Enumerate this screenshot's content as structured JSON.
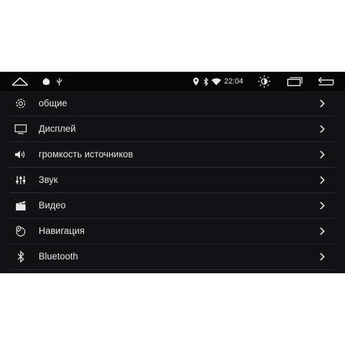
{
  "status_bar": {
    "time": "22:04",
    "icons": [
      "home-icon",
      "app-icon",
      "usb-icon",
      "location-icon",
      "bluetooth-icon",
      "wifi-icon",
      "brightness-icon",
      "recents-icon",
      "back-icon"
    ]
  },
  "settings": {
    "items": [
      {
        "label": "общие",
        "icon": "gear-icon"
      },
      {
        "label": "Дисплей",
        "icon": "display-icon"
      },
      {
        "label": "громкость источников",
        "icon": "volume-icon"
      },
      {
        "label": "Звук",
        "icon": "equalizer-icon"
      },
      {
        "label": "Видео",
        "icon": "video-icon"
      },
      {
        "label": "Навигация",
        "icon": "navigation-icon"
      },
      {
        "label": "Bluetooth",
        "icon": "bluetooth-icon"
      }
    ]
  },
  "colors": {
    "background": "#121215",
    "status_bar": "#060607",
    "text": "#e6e6e6",
    "divider": "#2c2c30"
  }
}
